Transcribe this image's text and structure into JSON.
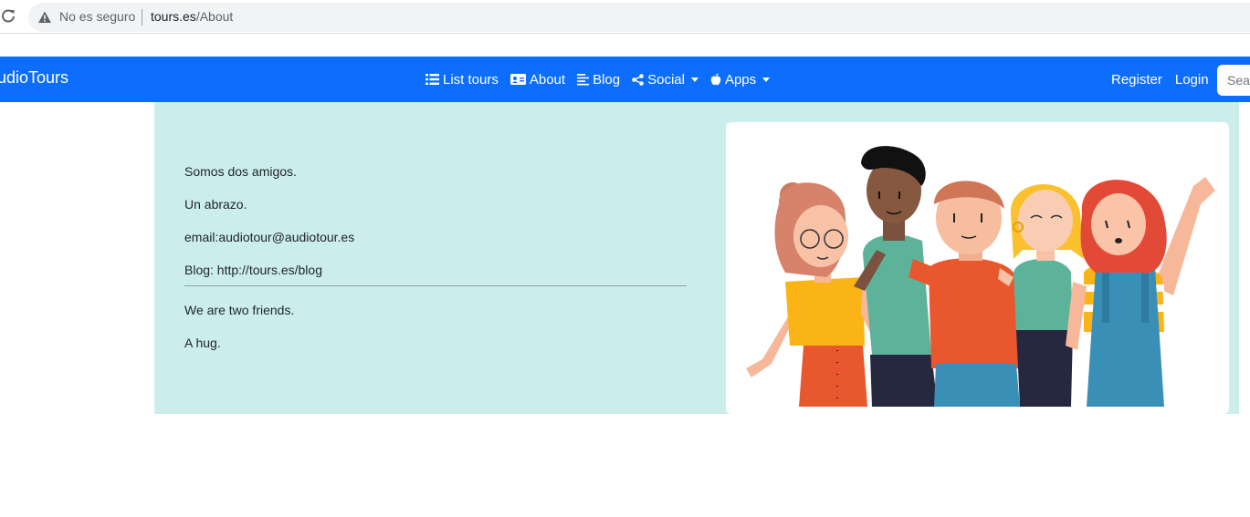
{
  "browser": {
    "security_label": "No es seguro",
    "url_host": "tours.es",
    "url_path": "/About"
  },
  "navbar": {
    "brand": "udioTours",
    "items": [
      {
        "label": "List tours",
        "icon": "list-icon"
      },
      {
        "label": "About",
        "icon": "id-card-icon"
      },
      {
        "label": "Blog",
        "icon": "text-lines-icon"
      },
      {
        "label": "Social",
        "icon": "share-icon",
        "dropdown": true
      },
      {
        "label": "Apps",
        "icon": "apple-icon",
        "dropdown": true
      }
    ],
    "register": "Register",
    "login": "Login",
    "search_placeholder": "Search",
    "color": "#0d6efd"
  },
  "about": {
    "paragraphs_es": [
      "Somos dos amigos.",
      "Un abrazo.",
      "email:audiotour@audiotour.es",
      "Blog: http://tours.es/blog"
    ],
    "paragraphs_en": [
      "We are two friends.",
      "A hug."
    ],
    "background": "#cbeeed"
  }
}
